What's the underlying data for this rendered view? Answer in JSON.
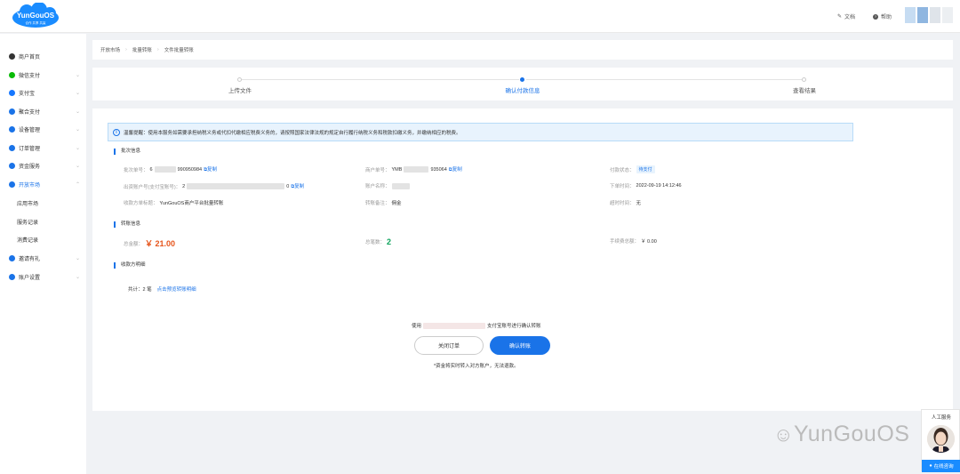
{
  "header": {
    "logo_text": "YunGouOS",
    "logo_sub": "合作 共享 共赢",
    "docs_label": "文档",
    "help_label": "帮助"
  },
  "sidebar": {
    "items": [
      {
        "label": "商户首页",
        "icon": "home-icon",
        "color": "#333333"
      },
      {
        "label": "微信支付",
        "icon": "wechat-icon",
        "color": "#09bb07"
      },
      {
        "label": "支付宝",
        "icon": "alipay-icon",
        "color": "#1677ff"
      },
      {
        "label": "聚合支付",
        "icon": "aggregate-icon",
        "color": "#1a73e8"
      },
      {
        "label": "设备管理",
        "icon": "device-icon",
        "color": "#1a73e8"
      },
      {
        "label": "订单管理",
        "icon": "order-icon",
        "color": "#1a73e8"
      },
      {
        "label": "资金服务",
        "icon": "funds-icon",
        "color": "#1a73e8"
      },
      {
        "label": "开放市场",
        "icon": "market-icon",
        "color": "#1a73e8"
      },
      {
        "label": "邀请有礼",
        "icon": "gift-icon",
        "color": "#1a73e8"
      },
      {
        "label": "账户设置",
        "icon": "settings-icon",
        "color": "#1a73e8"
      }
    ],
    "sub_items": [
      "应用市场",
      "服务记录",
      "消费记录"
    ]
  },
  "breadcrumb": {
    "items": [
      "开放市场",
      "批量转账",
      "文件批量转账"
    ]
  },
  "steps": [
    {
      "label": "上传文件",
      "active": false
    },
    {
      "label": "确认付款信息",
      "active": true
    },
    {
      "label": "查看结果",
      "active": false
    }
  ],
  "notice": "温馨提醒：使用本服务如需要承担纳税义务或代扣代缴相应税费义务的，请按照国家法律法规的规定自行履行纳税义务和税款扣缴义务，并缴纳相应的税费。",
  "batch": {
    "title": "批次信息",
    "batch_no_label": "批次单号：",
    "batch_no_prefix": "6",
    "batch_no_suffix": "990950984",
    "copy_label": "复制",
    "merchant_no_label": "商户单号：",
    "merchant_no_prefix": "YMB",
    "merchant_no_suffix": "935064",
    "pay_status_label": "付款状态：",
    "pay_status": "待支付",
    "payer_label": "出资账户号(支付宝账号)：",
    "payer_prefix": "2",
    "payer_suffix": "0",
    "account_name_label": "账户名称：",
    "order_time_label": "下单时间：",
    "order_time": "2022-09-19 14:12:46",
    "order_title_label": "收款方单标题：",
    "order_title": "YunGouOS商户平台批量转账",
    "remark_label": "转账备注：",
    "remark": "佣金",
    "timeout_label": "超时时间：",
    "timeout": "无"
  },
  "transfer": {
    "title": "转账信息",
    "total_amount_label": "总金额：",
    "total_amount": "￥ 21.00",
    "total_count_label": "总笔数：",
    "total_count": "2",
    "fee_label": "手续费总额：",
    "fee": "￥ 0.00"
  },
  "payee": {
    "title": "收款方明细",
    "total_label": "共计：2 笔",
    "view_link": "点击预览转账明细"
  },
  "confirm": {
    "use_prefix": "使用",
    "use_suffix": "支付宝账号进行确认转账",
    "close_button": "关闭订单",
    "confirm_button": "确认转账",
    "note": "*资金将实时转入对方账户，无法退款。"
  },
  "watermark": "YunGouOS",
  "customer_service": {
    "title": "人工服务",
    "button": "在线咨询"
  },
  "colors": {
    "primary": "#1a73e8",
    "money": "#e6541b",
    "count": "#0aa25a"
  }
}
